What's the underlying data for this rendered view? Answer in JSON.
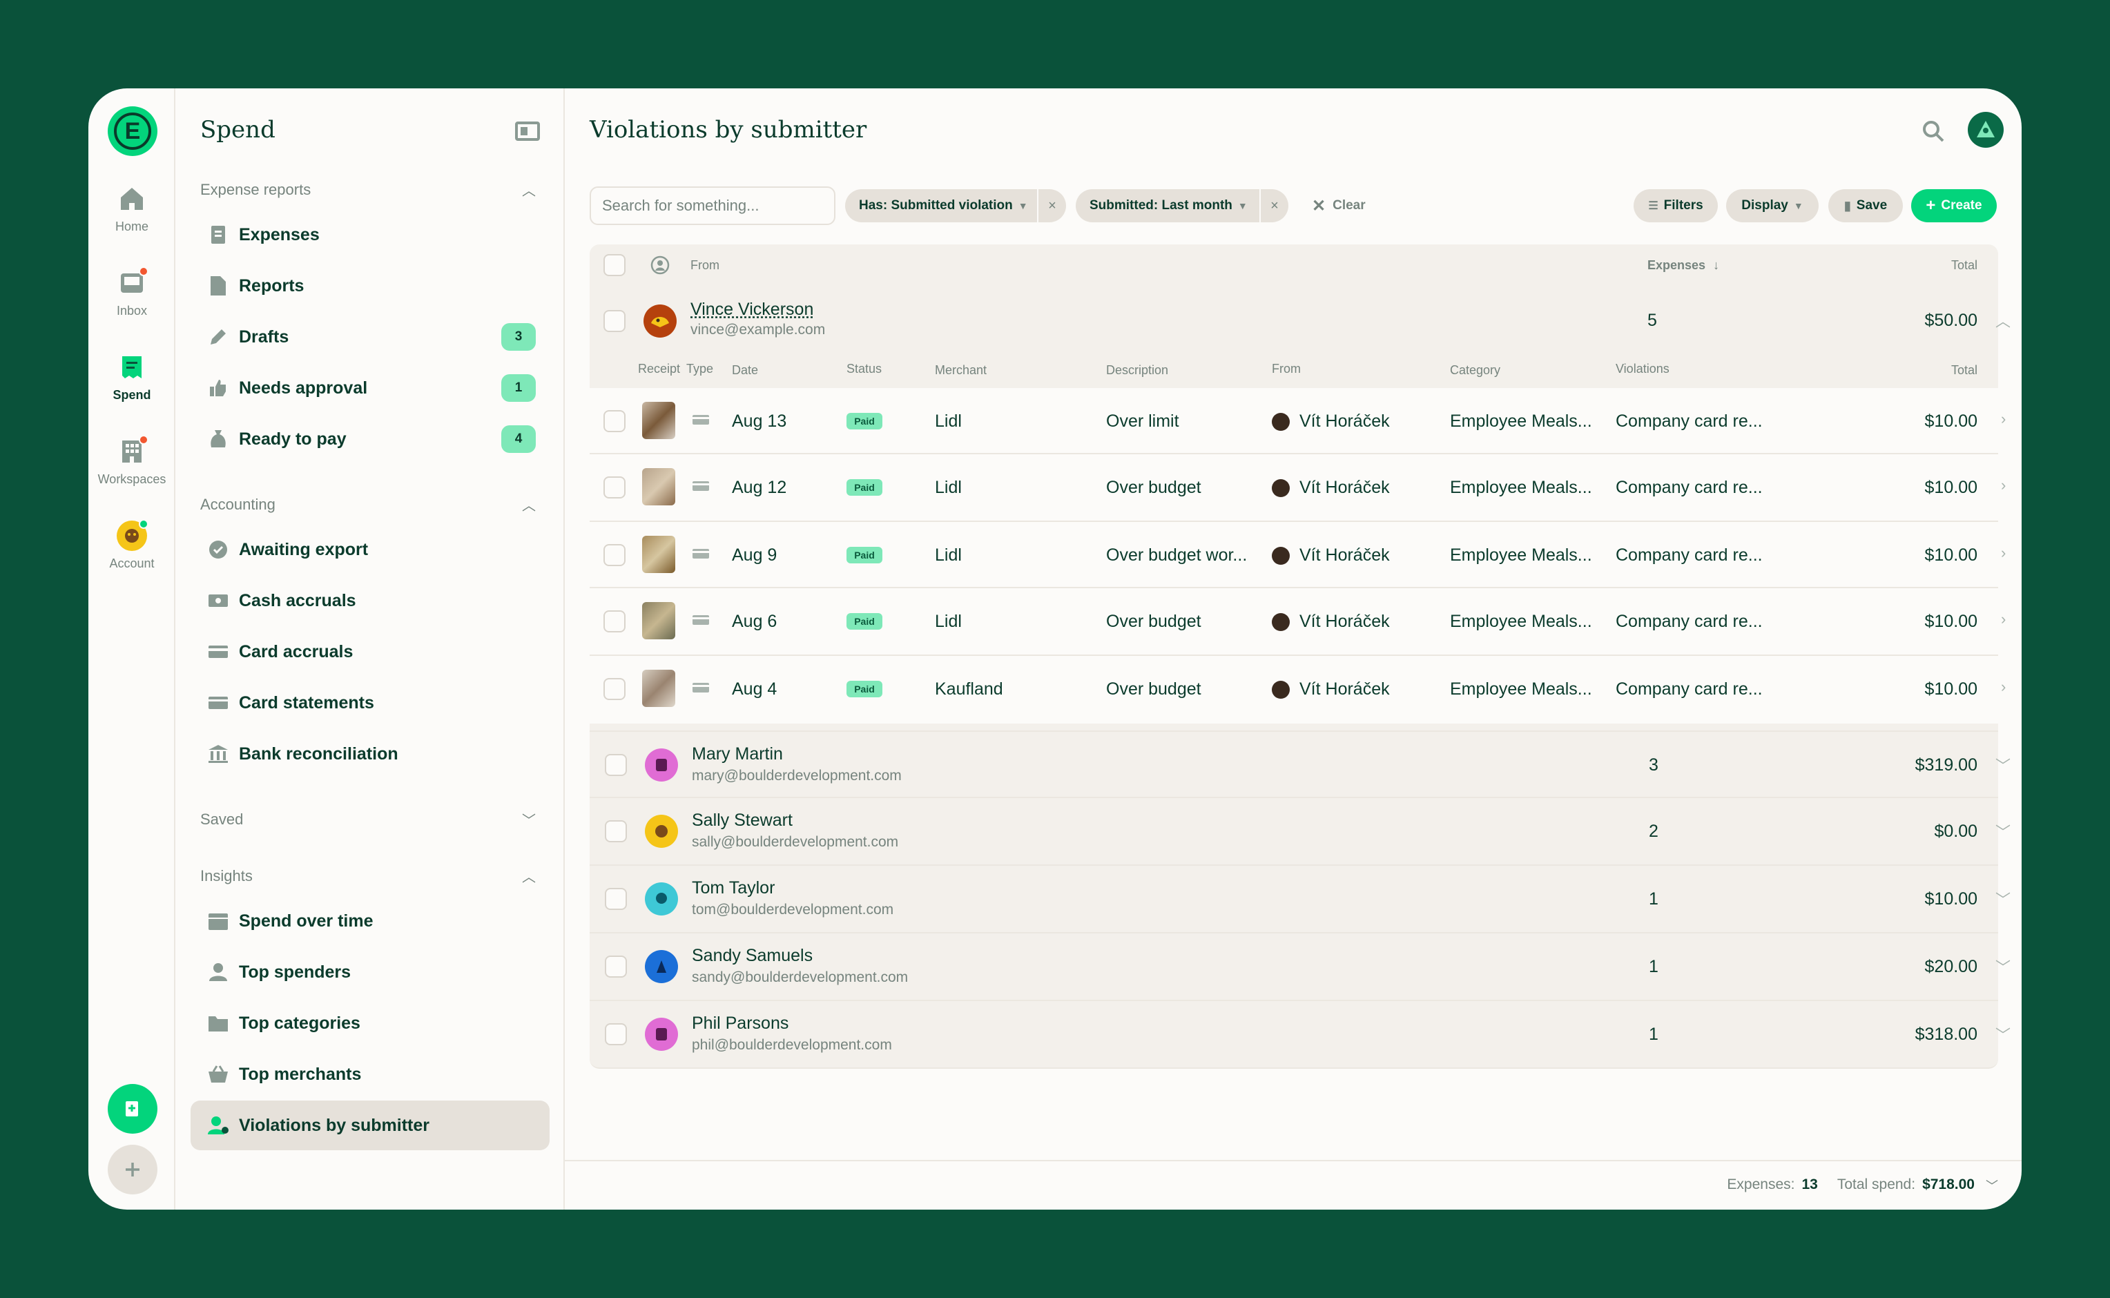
{
  "rail": {
    "items": [
      {
        "label": "Home",
        "icon": "home-icon"
      },
      {
        "label": "Inbox",
        "icon": "inbox-icon"
      },
      {
        "label": "Spend",
        "icon": "receipt-icon"
      },
      {
        "label": "Workspaces",
        "icon": "building-icon"
      },
      {
        "label": "Account",
        "icon": "account-avatar"
      }
    ]
  },
  "sidebar": {
    "title": "Spend",
    "sections": {
      "expense_reports": "Expense reports",
      "accounting": "Accounting",
      "saved": "Saved",
      "insights": "Insights"
    },
    "items": {
      "expenses": "Expenses",
      "reports": "Reports",
      "drafts": "Drafts",
      "drafts_count": "3",
      "needs_approval": "Needs approval",
      "needs_approval_count": "1",
      "ready_to_pay": "Ready to pay",
      "ready_to_pay_count": "4",
      "awaiting_export": "Awaiting export",
      "cash_accruals": "Cash accruals",
      "card_accruals": "Card accruals",
      "card_statements": "Card statements",
      "bank_reconciliation": "Bank reconciliation",
      "spend_over_time": "Spend over time",
      "top_spenders": "Top spenders",
      "top_categories": "Top categories",
      "top_merchants": "Top merchants",
      "violations_by_submitter": "Violations by submitter"
    }
  },
  "main": {
    "title": "Violations by submitter",
    "search_placeholder": "Search for something...",
    "filters": {
      "chip1": "Has: Submitted violation",
      "chip2": "Submitted: Last month",
      "clear": "Clear",
      "filters_btn": "Filters",
      "display_btn": "Display",
      "save_btn": "Save",
      "create_btn": "Create"
    },
    "columns": {
      "from": "From",
      "expenses": "Expenses",
      "total": "Total"
    },
    "subcolumns": {
      "receipt": "Receipt",
      "type": "Type",
      "date": "Date",
      "status": "Status",
      "merchant": "Merchant",
      "description": "Description",
      "from": "From",
      "category": "Category",
      "violations": "Violations",
      "total": "Total"
    },
    "expanded": {
      "name": "Vince Vickerson",
      "email": "vince@example.com",
      "count": "5",
      "total": "$50.00",
      "expenses": [
        {
          "date": "Aug 13",
          "status": "Paid",
          "merchant": "Lidl",
          "description": "Over limit",
          "from": "Vít Horáček",
          "category": "Employee Meals...",
          "violations": "Company card re...",
          "total": "$10.00"
        },
        {
          "date": "Aug 12",
          "status": "Paid",
          "merchant": "Lidl",
          "description": "Over budget",
          "from": "Vít Horáček",
          "category": "Employee Meals...",
          "violations": "Company card re...",
          "total": "$10.00"
        },
        {
          "date": "Aug 9",
          "status": "Paid",
          "merchant": "Lidl",
          "description": "Over budget wor...",
          "from": "Vít Horáček",
          "category": "Employee Meals...",
          "violations": "Company card re...",
          "total": "$10.00"
        },
        {
          "date": "Aug 6",
          "status": "Paid",
          "merchant": "Lidl",
          "description": "Over budget",
          "from": "Vít Horáček",
          "category": "Employee Meals...",
          "violations": "Company card re...",
          "total": "$10.00"
        },
        {
          "date": "Aug 4",
          "status": "Paid",
          "merchant": "Kaufland",
          "description": "Over budget",
          "from": "Vít Horáček",
          "category": "Employee Meals...",
          "violations": "Company card re...",
          "total": "$10.00"
        }
      ]
    },
    "submitters": [
      {
        "name": "Mary Martin",
        "email": "mary@boulderdevelopment.com",
        "count": "3",
        "total": "$319.00",
        "color": "#e06cd4"
      },
      {
        "name": "Sally Stewart",
        "email": "sally@boulderdevelopment.com",
        "count": "2",
        "total": "$0.00",
        "color": "#f5c518"
      },
      {
        "name": "Tom Taylor",
        "email": "tom@boulderdevelopment.com",
        "count": "1",
        "total": "$10.00",
        "color": "#3ec8d6"
      },
      {
        "name": "Sandy Samuels",
        "email": "sandy@boulderdevelopment.com",
        "count": "1",
        "total": "$20.00",
        "color": "#1b6fd8"
      },
      {
        "name": "Phil Parsons",
        "email": "phil@boulderdevelopment.com",
        "count": "1",
        "total": "$318.00",
        "color": "#e06cd4"
      }
    ]
  },
  "footer": {
    "expenses_label": "Expenses:",
    "expenses_value": "13",
    "total_label": "Total spend:",
    "total_value": "$718.00"
  },
  "colors": {
    "accent": "#03d47c",
    "background": "#0a523a",
    "badge": "#7ee8b8"
  }
}
